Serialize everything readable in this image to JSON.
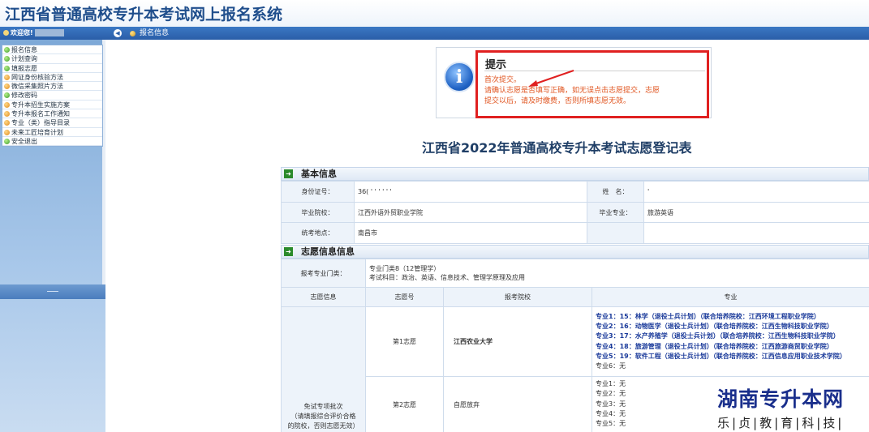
{
  "header": {
    "title": "江西省普通高校专升本考试网上报名系统"
  },
  "sidebar": {
    "welcome": "欢迎您!",
    "items": [
      {
        "label": "报名信息",
        "dot": "green"
      },
      {
        "label": "计划查询",
        "dot": "green"
      },
      {
        "label": "填报志愿",
        "dot": "green"
      },
      {
        "label": "网证身份核验方法",
        "dot": "orange"
      },
      {
        "label": "微信采集照片方法",
        "dot": "orange"
      },
      {
        "label": "修改密码",
        "dot": "green"
      },
      {
        "label": "专升本招生实施方案",
        "dot": "orange"
      },
      {
        "label": "专升本报名工作通知",
        "dot": "orange"
      },
      {
        "label": "专业（类）指导目录",
        "dot": "orange"
      },
      {
        "label": "未来工匠培育计划",
        "dot": "orange"
      },
      {
        "label": "安全退出",
        "dot": "green"
      }
    ]
  },
  "breadcrumb": {
    "current": "报名信息"
  },
  "notice": {
    "title": "提示",
    "lines": [
      "首次提交。",
      "请确认志愿是否填写正确，如无误点击志愿提交，志愿",
      "提交以后，请及时缴费，否则所填志愿无效。"
    ]
  },
  "form_title": "江西省2022年普通高校专升本考试志愿登记表",
  "basic": {
    "section": "基本信息",
    "id_label": "身份证号：",
    "id_value": "36( '  '  '  '   '  ' ",
    "name_label": "姓　名：",
    "name_value": "'",
    "school_label": "毕业院校：",
    "school_value": "江西外语外贸职业学院",
    "major_label": "毕业专业：",
    "major_value": "旅游英语",
    "site_label": "统考地点：",
    "site_value": "南昌市"
  },
  "volunteer": {
    "section": "志愿信息信息",
    "category_label": "报考专业门类：",
    "category_line1": "专业门类8（12管理学）",
    "category_line2": "考试科目：政治、英语、信息技术、管理学原理及应用",
    "headers": [
      "志愿信息",
      "志愿号",
      "报考院校",
      "专业"
    ],
    "batch_label_lines": [
      "免试专项批次",
      "（请填报综合评价合格",
      "的院校，否则志愿无效）"
    ],
    "choices": [
      {
        "number": "第1志愿",
        "school": "江西农业大学",
        "majors": [
          "专业1：15：林学（退役士兵计划）（联合培养院校：江西环境工程职业学院）",
          "专业2：16：动物医学（退役士兵计划）（联合培养院校：江西生物科技职业学院）",
          "专业3：17：水产养殖学（退役士兵计划）（联合培养院校：江西生物科技职业学院）",
          "专业4：18：旅游管理（退役士兵计划）（联合培养院校：江西旅游商贸职业学院）",
          "专业5：19：软件工程（退役士兵计划）（联合培养院校：江西信息应用职业技术学院）",
          "专业6：无"
        ]
      },
      {
        "number": "第2志愿",
        "school": "自愿放弃",
        "majors": [
          "专业1：无",
          "专业2：无",
          "专业3：无",
          "专业4：无",
          "专业5：无"
        ]
      }
    ]
  },
  "watermark": {
    "big": "湖南专升本网",
    "small": "乐|贞|教|育|科|技|"
  }
}
